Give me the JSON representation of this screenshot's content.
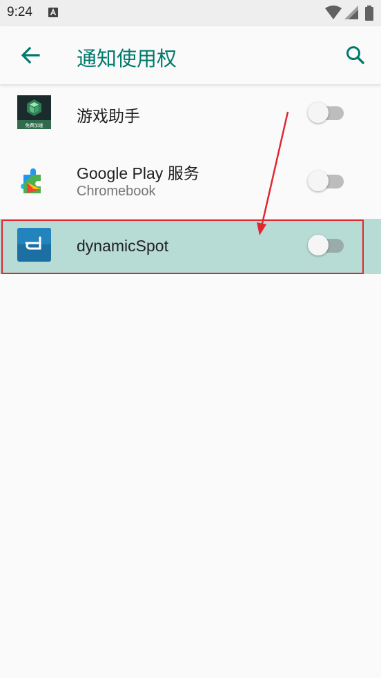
{
  "status_bar": {
    "time": "9:24",
    "notification_icon": "a-letter-icon",
    "icons": [
      "wifi-icon",
      "signal-icon",
      "battery-icon"
    ]
  },
  "toolbar": {
    "title": "通知使用权",
    "back_icon": "arrow-back-icon",
    "search_icon": "search-icon"
  },
  "apps": [
    {
      "name": "游戏助手",
      "icon": "game-assistant-icon",
      "icon_caption": "免费加速",
      "enabled": false
    },
    {
      "name": "Google Play 服务",
      "subtitle": "Chromebook",
      "icon": "google-play-services-icon",
      "enabled": false
    },
    {
      "name": "dynamicSpot",
      "icon": "dynamicspot-icon",
      "enabled": false,
      "highlighted": true
    }
  ],
  "colors": {
    "accent": "#00796b",
    "highlight_row": "#b7dbd5",
    "annotation": "#e0262f"
  }
}
